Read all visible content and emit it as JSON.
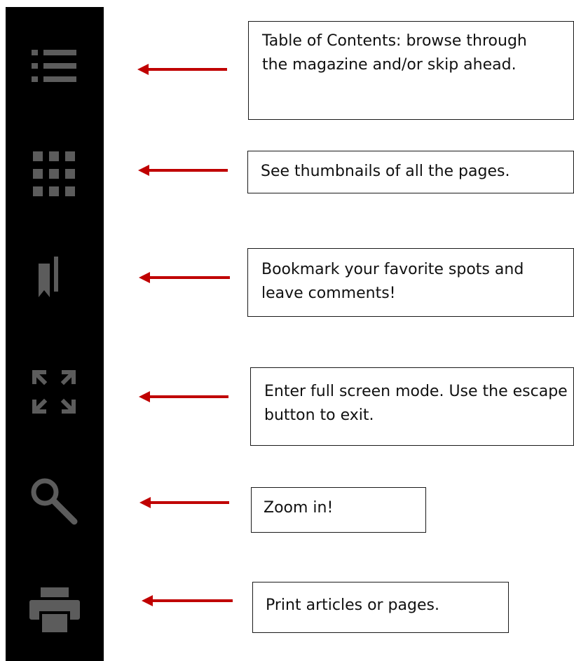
{
  "toolbar": {
    "icons": [
      {
        "name": "table-of-contents-icon"
      },
      {
        "name": "thumbnails-grid-icon"
      },
      {
        "name": "bookmark-icon"
      },
      {
        "name": "fullscreen-icon"
      },
      {
        "name": "zoom-search-icon"
      },
      {
        "name": "print-icon"
      }
    ]
  },
  "colors": {
    "toolbar_bg": "#000000",
    "icon_gray": "#5c5c5c",
    "arrow_red": "#c00000",
    "callout_border": "#1a1a1a"
  },
  "callouts": {
    "toc": "Table of Contents: browse through the magazine and/or skip ahead.",
    "thumbnails": "See thumbnails of all the pages.",
    "bookmark": "Bookmark your favorite spots and leave comments!",
    "fullscreen": "Enter full screen mode. Use the escape button to exit.",
    "zoom": "Zoom in!",
    "print": "Print articles or pages."
  }
}
